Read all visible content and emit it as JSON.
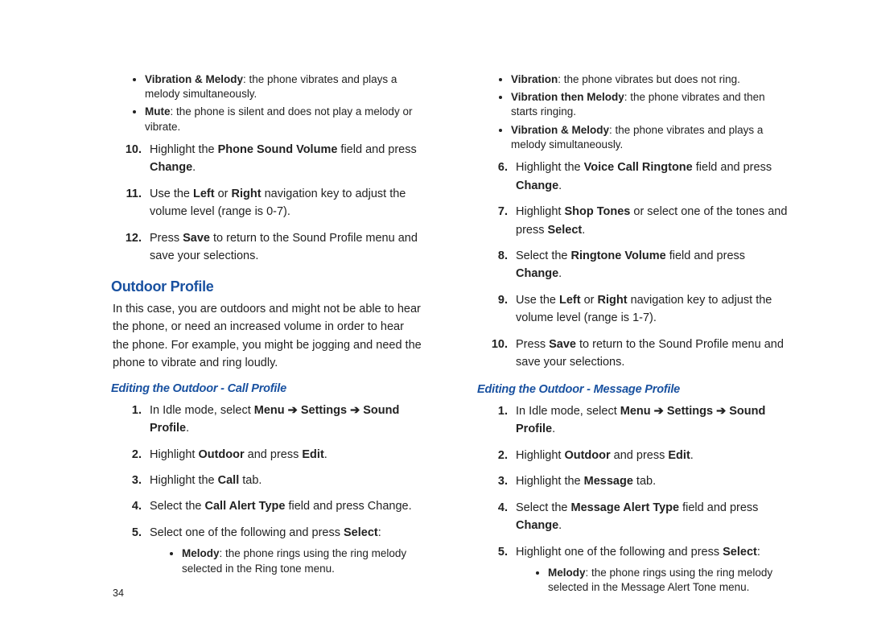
{
  "left": {
    "topBullets": [
      {
        "b": "Vibration & Melody",
        "t": ": the phone vibrates and plays a melody simultaneously."
      },
      {
        "b": "Mute",
        "t": ": the phone is silent and does not play a melody or vibrate."
      }
    ],
    "step10_a": "Highlight the ",
    "step10_b": "Phone Sound Volume",
    "step10_c": " field and press ",
    "step10_d": "Change",
    "step10_e": ".",
    "step11_a": "Use the ",
    "step11_b": "Left",
    "step11_c": " or ",
    "step11_d": "Right",
    "step11_e": " navigation key to adjust the volume level (range is 0-7).",
    "step12_a": "Press ",
    "step12_b": "Save",
    "step12_c": " to return to the Sound Profile menu and save your selections.",
    "section": "Outdoor Profile",
    "intro": "In this case, you are outdoors and might not be able to hear the phone, or need an increased volume in order to hear the phone. For example, you might be jogging and need the phone to vibrate and ring loudly.",
    "subhead": "Editing the Outdoor - Call Profile",
    "s1_a": "In Idle mode, select ",
    "s1_b": "Menu",
    "s1_arrow1": " ➔ ",
    "s1_c": "Settings",
    "s1_arrow2": " ➔ ",
    "s1_d": "Sound Profile",
    "s1_e": ".",
    "s2_a": "Highlight ",
    "s2_b": "Outdoor",
    "s2_c": " and press ",
    "s2_d": "Edit",
    "s2_e": ".",
    "s3_a": "Highlight the ",
    "s3_b": "Call",
    "s3_c": " tab.",
    "s4_a": "Select the ",
    "s4_b": "Call Alert Type",
    "s4_c": " field and press Change.",
    "s5_a": "Select one of the following and press ",
    "s5_b": "Select",
    "s5_c": ":",
    "s5Bullets": [
      {
        "b": "Melody",
        "t": ": the phone rings using the ring melody selected in the Ring tone menu."
      }
    ],
    "pagenum": "34"
  },
  "right": {
    "topBullets": [
      {
        "b": "Vibration",
        "t": ": the phone vibrates but does not ring."
      },
      {
        "b": "Vibration then Melody",
        "t": ": the phone vibrates and then starts ringing."
      },
      {
        "b": "Vibration & Melody",
        "t": ": the phone vibrates and plays a melody simultaneously."
      }
    ],
    "s6_a": "Highlight the ",
    "s6_b": "Voice Call Ringtone",
    "s6_c": " field and press ",
    "s6_d": "Change",
    "s6_e": ".",
    "s7_a": "Highlight ",
    "s7_b": "Shop Tones",
    "s7_c": " or select one of the tones and press ",
    "s7_d": "Select",
    "s7_e": ".",
    "s8_a": "Select the ",
    "s8_b": "Ringtone Volume",
    "s8_c": " field and press ",
    "s8_d": "Change",
    "s8_e": ".",
    "s9_a": "Use the ",
    "s9_b": "Left",
    "s9_c": " or ",
    "s9_d": "Right",
    "s9_e": " navigation key to adjust the volume level (range is 1-7).",
    "s10_a": "Press ",
    "s10_b": "Save",
    "s10_c": " to return to the Sound Profile menu and save your selections.",
    "subhead": "Editing the Outdoor - Message Profile",
    "m1_a": "In Idle mode, select ",
    "m1_b": "Menu",
    "m1_arrow1": " ➔ ",
    "m1_c": "Settings",
    "m1_arrow2": " ➔ ",
    "m1_d": "Sound Profile",
    "m1_e": ".",
    "m2_a": "Highlight ",
    "m2_b": "Outdoor",
    "m2_c": " and press ",
    "m2_d": "Edit",
    "m2_e": ".",
    "m3_a": "Highlight the ",
    "m3_b": "Message",
    "m3_c": " tab.",
    "m4_a": "Select the ",
    "m4_b": "Message Alert Type",
    "m4_c": " field and press ",
    "m4_d": "Change",
    "m4_e": ".",
    "m5_a": "Highlight one of the following and press ",
    "m5_b": "Select",
    "m5_c": ":",
    "m5Bullets": [
      {
        "b": "Melody",
        "t": ": the phone rings using the ring melody selected in the Message Alert Tone menu."
      }
    ]
  }
}
